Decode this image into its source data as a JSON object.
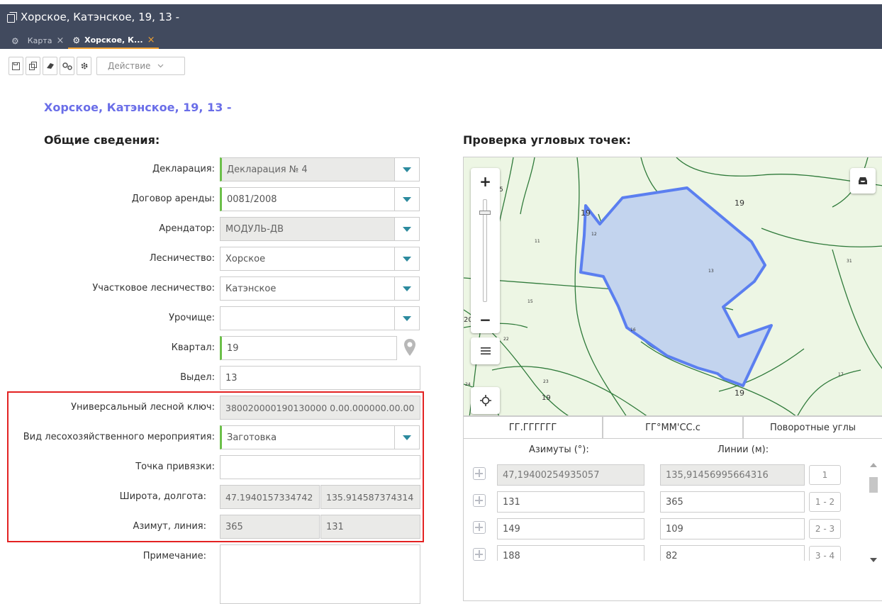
{
  "window": {
    "title": "Хорское, Катэнское, 19, 13 -",
    "tabs": [
      {
        "label": "Карта",
        "close": "×"
      },
      {
        "label": "Хорское, К...",
        "close": "×"
      }
    ]
  },
  "toolbar": {
    "action_label": "Действие",
    "icons": [
      "save-icon",
      "copy-icon",
      "eraser-icon",
      "cogs-icon",
      "gear-icon"
    ]
  },
  "page_title": "Хорское, Катэнское, 19, 13 -",
  "general": {
    "heading": "Общие сведения:",
    "fields": {
      "declaration": {
        "label": "Декларация:",
        "value": "Декларация № 4"
      },
      "lease": {
        "label": "Договор аренды:",
        "value": "0081/2008"
      },
      "tenant": {
        "label": "Арендатор:",
        "value": "МОДУЛЬ-ДВ"
      },
      "forestry": {
        "label": "Лесничество:",
        "value": "Хорское"
      },
      "district_forestry": {
        "label": "Участковое лесничество:",
        "value": "Катэнское"
      },
      "tract": {
        "label": "Урочище:",
        "value": ""
      },
      "quarter": {
        "label": "Квартал:",
        "value": "19"
      },
      "allotment": {
        "label": "Выдел:",
        "value": "13"
      },
      "forest_key": {
        "label": "Универсальный лесной ключ:",
        "value": "380020000190130000 0.00.000000.00.00"
      },
      "activity_type": {
        "label": "Вид лесохозяйственного мероприятия:",
        "value": "Заготовка"
      },
      "anchor_point": {
        "label": "Точка привязки:",
        "value": ""
      },
      "lat_lon": {
        "label": "Широта, долгота:",
        "lat": "47.1940157334742",
        "lon": "135.914587374314"
      },
      "azimuth_line": {
        "label": "Азимут, линия:",
        "azimuth": "365",
        "line": "131"
      },
      "note": {
        "label": "Примечание:",
        "value": ""
      }
    }
  },
  "corner_check": {
    "heading": "Проверка угловых точек:",
    "map": {
      "zoom_in": "+",
      "zoom_out": "−",
      "labels": [
        "19",
        "19",
        "12",
        "11",
        "13",
        "31",
        "15",
        "16",
        "20",
        "22",
        "23",
        "19",
        "17",
        "24",
        "5",
        "19"
      ]
    },
    "tabs": [
      "ГГ.ГГГГГГ",
      "ГГ°ММ'СС.с",
      "Поворотные углы"
    ],
    "columns": {
      "azimuths": "Азимуты (°):",
      "lines": "Линии (м):"
    },
    "rows": [
      {
        "azimuth": "47,19400254935057",
        "line": "135,91456995664316",
        "index": "1"
      },
      {
        "azimuth": "131",
        "line": "365",
        "index": "1 - 2"
      },
      {
        "azimuth": "149",
        "line": "109",
        "index": "2 - 3"
      },
      {
        "azimuth": "188",
        "line": "82",
        "index": "3 - 4"
      }
    ]
  },
  "colors": {
    "header_bg": "#414a5e",
    "title_accent": "#6a6ee8",
    "required_marker": "#6cc04a",
    "dropdown_arrow": "#2c8a9e",
    "highlight_box": "#e32222",
    "polygon_stroke": "#5b7ff0",
    "polygon_fill": "#c3d4ee"
  }
}
